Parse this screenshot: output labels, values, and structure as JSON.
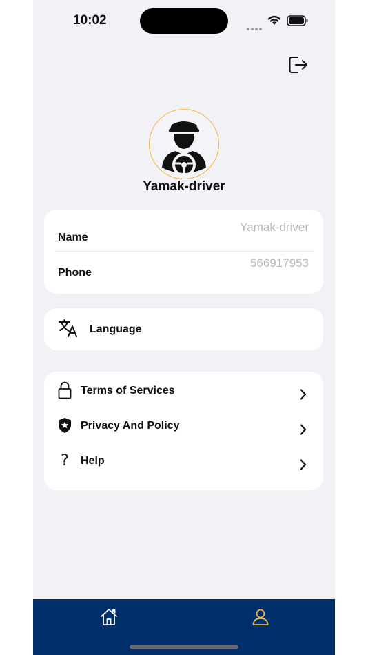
{
  "status_bar": {
    "time": "10:02"
  },
  "profile": {
    "username": "Yamak-driver"
  },
  "info": {
    "name_label": "Name",
    "name_value": "Yamak-driver",
    "phone_label": "Phone",
    "phone_value": "566917953"
  },
  "language": {
    "label": "Language",
    "icon": "translate-icon"
  },
  "menu": {
    "items": [
      {
        "label": "Terms of Services",
        "icon": "lock-icon"
      },
      {
        "label": "Privacy And Policy",
        "icon": "shield-star-icon"
      },
      {
        "label": "Help",
        "icon": "question-icon"
      }
    ]
  },
  "nav": {
    "home_icon": "home-icon",
    "profile_icon": "user-icon",
    "active": "profile"
  },
  "colors": {
    "background": "#f2f1f6",
    "card": "#ffffff",
    "nav_bar": "#002f6c",
    "accent": "#f0b63a",
    "muted_text": "#b9b9bd"
  }
}
